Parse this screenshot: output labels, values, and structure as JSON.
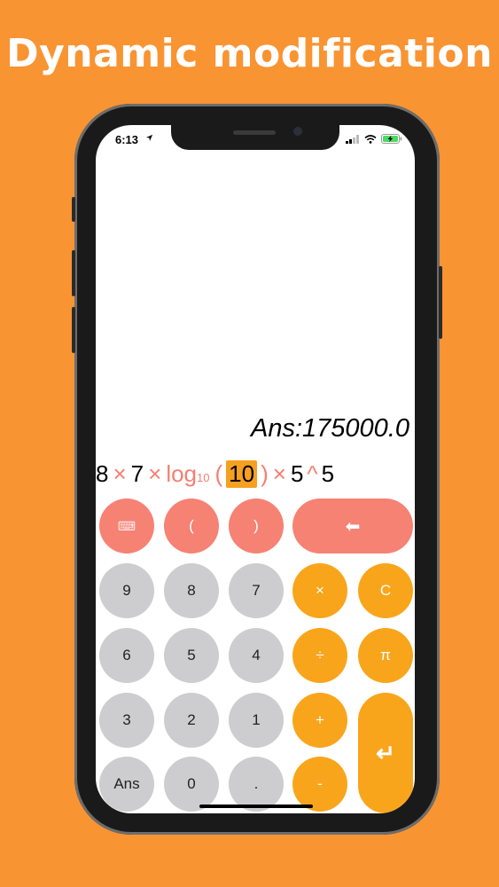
{
  "banner": {
    "title": "Dynamic modification"
  },
  "status_bar": {
    "time": "6:13"
  },
  "display": {
    "answer": "Ans:175000.0",
    "expression": {
      "t1": "8",
      "op1": "×",
      "t2": "7",
      "op2": "×",
      "fn": "log",
      "fn_sub": "10",
      "lparen": "(",
      "sel": "10",
      "rparen": ")",
      "op3": "×",
      "t3": "5",
      "op4": "^",
      "t4": "5"
    }
  },
  "keypad": {
    "keyboard": "⌨",
    "lparen": "(",
    "rparen": ")",
    "backspace": "⬅",
    "k9": "9",
    "k8": "8",
    "k7": "7",
    "times": "×",
    "clear": "C",
    "k6": "6",
    "k5": "5",
    "k4": "4",
    "divide": "÷",
    "pi": "π",
    "k3": "3",
    "k2": "2",
    "k1": "1",
    "plus": "+",
    "enter": "↵",
    "ans": "Ans",
    "k0": "0",
    "dot": ".",
    "minus": "-"
  },
  "colors": {
    "background": "#F99432",
    "salmon": "#F68274",
    "orange": "#F9A51C",
    "gray": "#CDCDCF",
    "highlight": "#F6A020"
  }
}
